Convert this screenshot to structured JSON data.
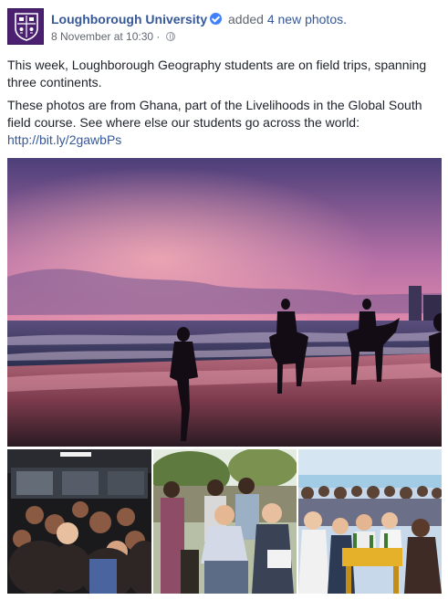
{
  "post": {
    "page_name": "Loughborough University",
    "action_text": "added",
    "action_link": "4 new photos.",
    "timestamp": "8 November at 10:30",
    "separator": "·",
    "privacy_icon": "globe-icon",
    "paragraph_1": "This week, Loughborough Geography students are on field trips, spanning three continents.",
    "paragraph_2": "These photos are from Ghana, part of the Livelihoods in the Global South field course. See where else our students go across the world:",
    "link": "http://bit.ly/2gawbPs"
  },
  "colors": {
    "brand_purple": "#4b2071",
    "link_blue": "#365899",
    "verified_blue": "#4080ff"
  }
}
